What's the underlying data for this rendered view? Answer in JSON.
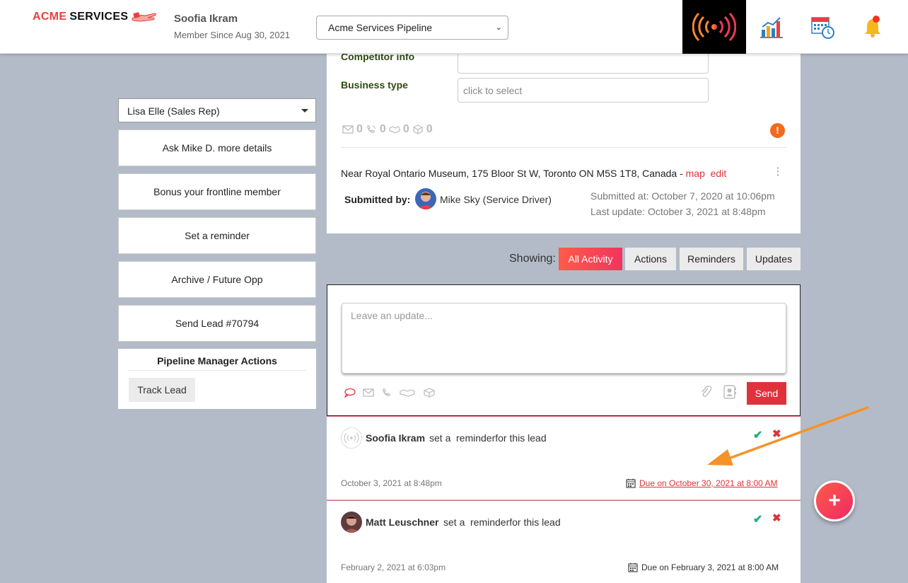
{
  "brand": {
    "name_part1": "ACME",
    "name_part2": "SERVICES"
  },
  "user": {
    "name": "Soofia Ikram",
    "since": "Member Since Aug 30, 2021"
  },
  "pipeline": {
    "selected": "Acme Services Pipeline"
  },
  "header_icons": [
    "live-signal-icon",
    "chart-icon",
    "calendar-clock-icon",
    "bell-icon"
  ],
  "sidebar": {
    "rep_selected": "Lisa Elle (Sales Rep)",
    "actions": [
      "Ask Mike D. more details",
      "Bonus your frontline member",
      "Set a reminder",
      "Archive / Future Opp",
      "Send Lead #70794"
    ],
    "pipeline_manager": {
      "title": "Pipeline Manager Actions",
      "track_label": "Track Lead"
    }
  },
  "lead": {
    "competitor_label": "Competitor info",
    "business_type_label": "Business type",
    "business_type_placeholder": "click to select",
    "counts": {
      "email": "0",
      "call": "0",
      "meeting": "0",
      "package": "0"
    },
    "address": "Near Royal Ontario Museum, 175 Bloor St W, Toronto ON M5S 1T8, Canada -",
    "map_link": "map",
    "edit_link": "edit",
    "submitted_by_label": "Submitted by:",
    "submitter": "Mike Sky (Service Driver)",
    "submitted_at": "Submitted at: October 7, 2020 at 10:06pm",
    "last_update": "Last update: October 3, 2021 at 8:48pm"
  },
  "filters": {
    "label": "Showing:",
    "tabs": [
      "All Activity",
      "Actions",
      "Reminders",
      "Updates"
    ],
    "active": "All Activity"
  },
  "composer": {
    "placeholder": "Leave an update...",
    "send_label": "Send"
  },
  "activities": [
    {
      "name": "Soofia Ikram",
      "action": "set a",
      "what": "reminderfor this lead",
      "date": "October 3, 2021 at 8:48pm",
      "due": "Due on October 30, 2021 at 8:00 AM"
    },
    {
      "name": "Matt Leuschner",
      "action": "set a",
      "what": "reminderfor this lead",
      "date": "February 2, 2021 at 6:03pm",
      "due": "Due on February 3, 2021 at 8:00 AM"
    }
  ],
  "colors": {
    "accent": "#e0323b",
    "brand_gradient_start": "#fe5b4a",
    "brand_gradient_end": "#f2345d",
    "annotation_arrow": "#f5922a",
    "background": "#b3bbc8"
  }
}
